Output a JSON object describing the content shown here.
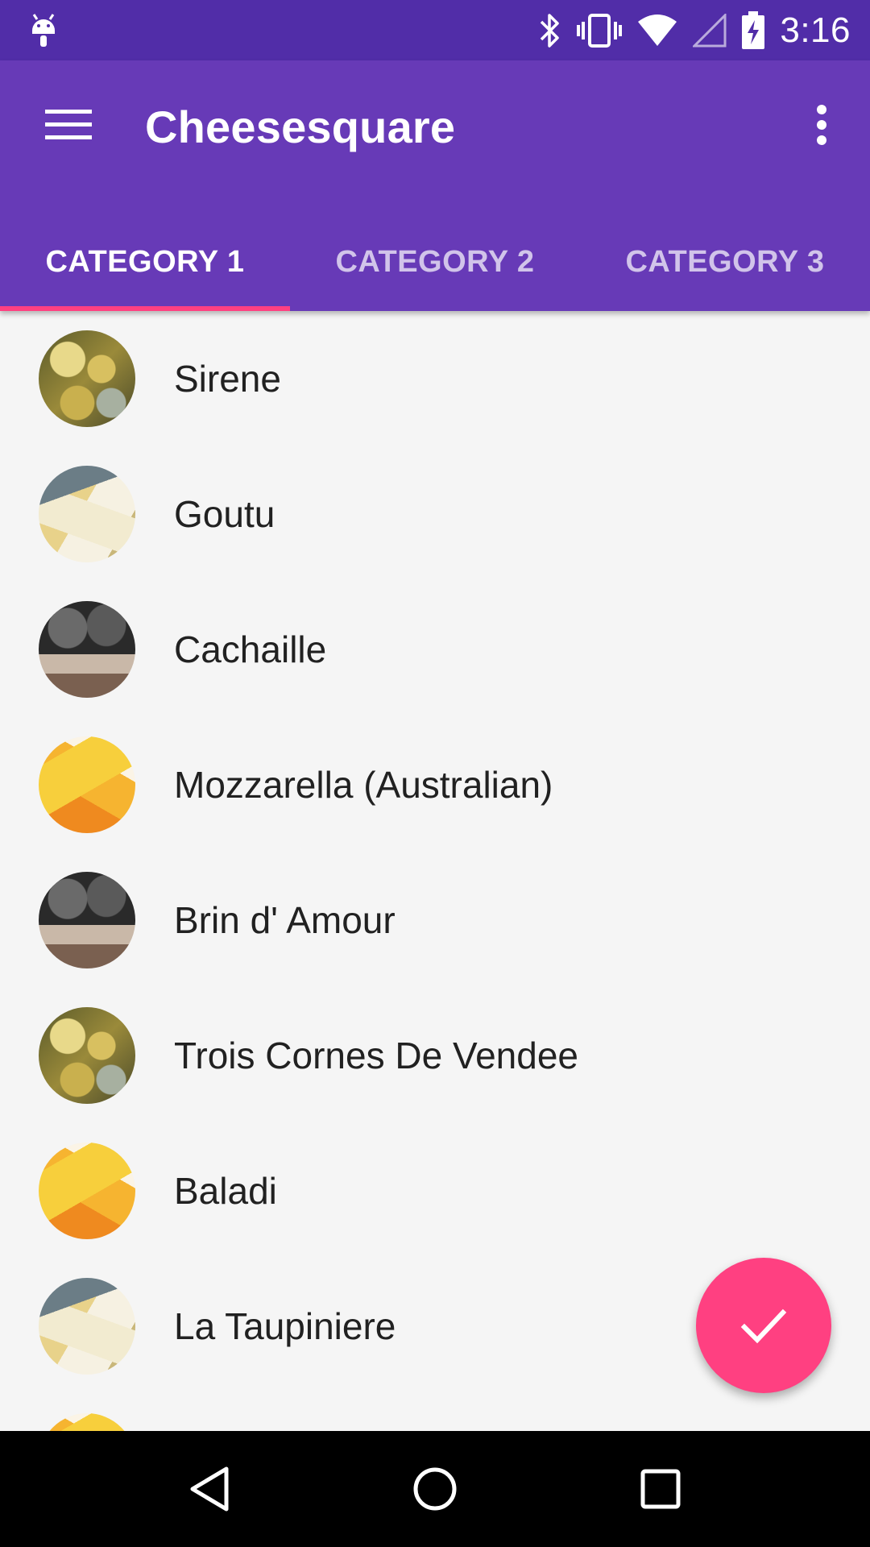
{
  "status_bar": {
    "time": "3:16",
    "icons": [
      "android-debug-icon",
      "bluetooth-icon",
      "vibrate-icon",
      "wifi-icon",
      "cell-signal-icon",
      "battery-charging-icon"
    ]
  },
  "app_bar": {
    "title": "Cheesesquare",
    "menu_icon": "hamburger-menu-icon",
    "overflow_icon": "more-vert-icon",
    "background_color": "#673ab7",
    "status_color": "#512da8"
  },
  "tabs": [
    {
      "label": "CATEGORY 1",
      "active": true
    },
    {
      "label": "CATEGORY 2",
      "active": false
    },
    {
      "label": "CATEGORY 3",
      "active": false
    }
  ],
  "list": [
    {
      "label": "Sirene",
      "avatar": "cheese-wheels"
    },
    {
      "label": "Goutu",
      "avatar": "cheese-blue-wedges"
    },
    {
      "label": "Cachaille",
      "avatar": "cheese-dark-rounds"
    },
    {
      "label": "Mozzarella (Australian)",
      "avatar": "cheese-yellow-slices"
    },
    {
      "label": "Brin d' Amour",
      "avatar": "cheese-dark-rounds"
    },
    {
      "label": "Trois Cornes De Vendee",
      "avatar": "cheese-wheels"
    },
    {
      "label": "Baladi",
      "avatar": "cheese-yellow-slices"
    },
    {
      "label": "La Taupiniere",
      "avatar": "cheese-blue-wedges"
    },
    {
      "label": "",
      "avatar": "cheese-yellow-slices"
    }
  ],
  "fab": {
    "icon": "check-icon",
    "color": "#ff4081"
  },
  "nav_bar": {
    "buttons": [
      "back-icon",
      "home-icon",
      "recents-icon"
    ]
  }
}
